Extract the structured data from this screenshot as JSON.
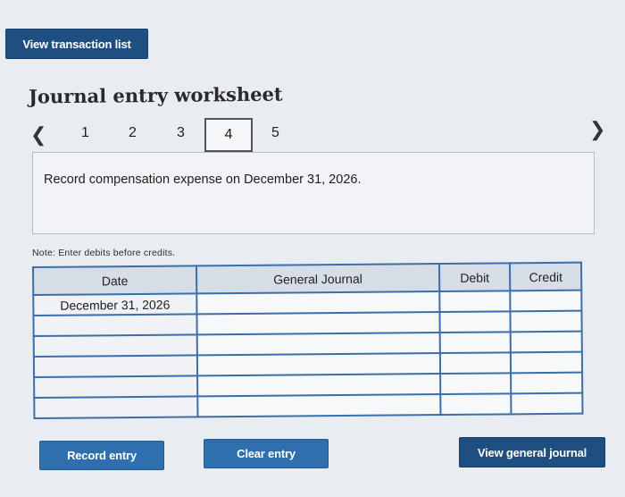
{
  "top_button": {
    "label": "View transaction list"
  },
  "worksheet": {
    "title": "Journal entry worksheet",
    "pager": {
      "prev_icon": "chevron-left-icon",
      "next_icon": "chevron-right-icon",
      "pages": [
        "1",
        "2",
        "3",
        "4",
        "5"
      ],
      "active": "4"
    },
    "instruction": "Record compensation expense on December 31, 2026.",
    "note": "Note: Enter debits before credits."
  },
  "table": {
    "headers": [
      "Date",
      "General Journal",
      "Debit",
      "Credit"
    ],
    "rows": [
      [
        "December 31, 2026",
        "",
        "",
        ""
      ],
      [
        "",
        "",
        "",
        ""
      ],
      [
        "",
        "",
        "",
        ""
      ],
      [
        "",
        "",
        "",
        ""
      ],
      [
        "",
        "",
        "",
        ""
      ],
      [
        "",
        "",
        "",
        ""
      ]
    ]
  },
  "actions": {
    "record": "Record entry",
    "clear": "Clear entry",
    "view_journal": "View general journal"
  },
  "colors": {
    "button_blue": "#2f6fae",
    "table_border": "#3a6fa8",
    "header_bg": "#d6dde6"
  }
}
